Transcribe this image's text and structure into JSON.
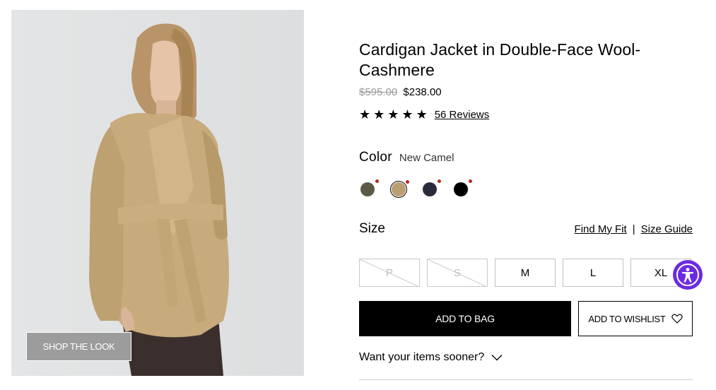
{
  "product": {
    "title": "Cardigan Jacket in Double-Face Wool-Cashmere",
    "price_original": "$595.00",
    "price_sale": "$238.00",
    "rating_stars": 5,
    "reviews_label": "56 Reviews"
  },
  "image": {
    "shop_the_look_label": "SHOP THE LOOK"
  },
  "color": {
    "label": "Color",
    "selected_value": "New Camel",
    "swatches": [
      {
        "name": "olive",
        "hex": "#5b5a46",
        "selected": false
      },
      {
        "name": "new-camel",
        "hex": "#bb9f72",
        "selected": true
      },
      {
        "name": "navy",
        "hex": "#2a2b3a",
        "selected": false
      },
      {
        "name": "black",
        "hex": "#000000",
        "selected": false
      }
    ]
  },
  "size": {
    "label": "Size",
    "find_my_fit": "Find My Fit",
    "separator": "|",
    "size_guide": "Size Guide",
    "options": [
      {
        "label": "P",
        "available": false
      },
      {
        "label": "S",
        "available": false
      },
      {
        "label": "M",
        "available": true
      },
      {
        "label": "L",
        "available": true
      },
      {
        "label": "XL",
        "available": true
      }
    ]
  },
  "actions": {
    "add_to_bag": "ADD TO BAG",
    "add_to_wishlist": "ADD TO WISHLIST"
  },
  "delivery": {
    "label": "Want your items sooner?"
  },
  "icons": {
    "star": "star-icon",
    "heart": "heart-icon",
    "chevron": "chevron-down-icon",
    "accessibility": "accessibility-icon"
  },
  "colors": {
    "accent_purple": "#6b2be0",
    "sale_dot": "#b52a1f"
  }
}
